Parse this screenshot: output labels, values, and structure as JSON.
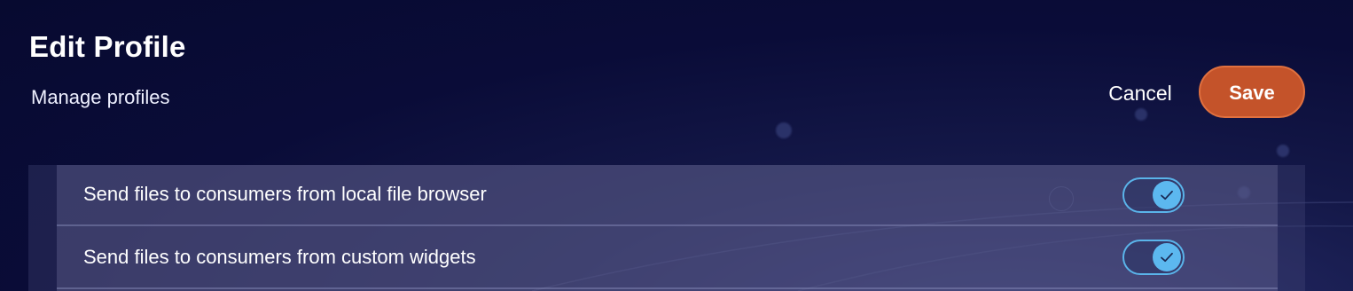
{
  "header": {
    "title": "Edit Profile",
    "subtitle": "Manage profiles"
  },
  "actions": {
    "cancel_label": "Cancel",
    "save_label": "Save"
  },
  "permissions": [
    {
      "label": "Send files to consumers from local file browser",
      "enabled": true,
      "icon": "check-icon"
    },
    {
      "label": "Send files to consumers from custom widgets",
      "enabled": true,
      "icon": "check-icon"
    }
  ],
  "colors": {
    "save_button": "#c4532a",
    "toggle_on": "#5cb8ef",
    "background": "#0a0c38"
  }
}
